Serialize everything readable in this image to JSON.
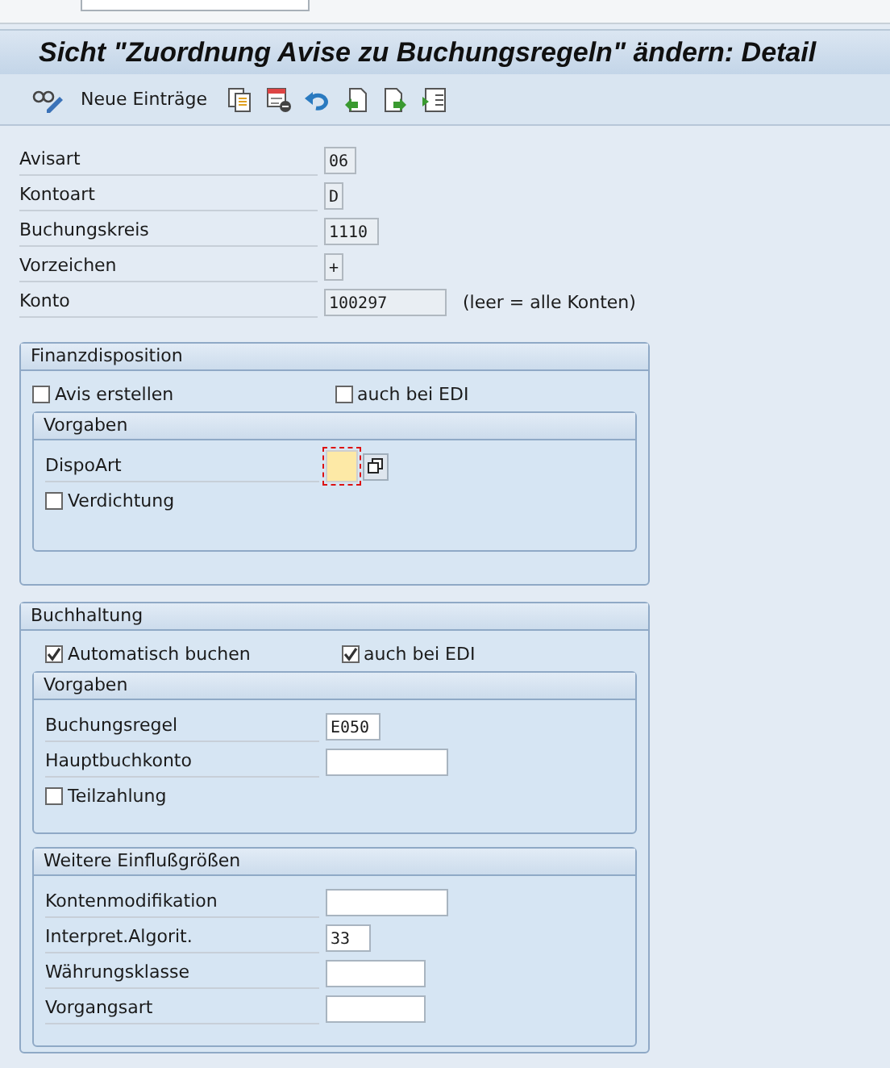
{
  "title": "Sicht \"Zuordnung Avise zu Buchungsregeln\" ändern: Detail",
  "toolbar": {
    "new_entries": "Neue Einträge"
  },
  "header_fields": [
    {
      "label": "Avisart",
      "value": "06",
      "kind": "display"
    },
    {
      "label": "Kontoart",
      "value": "D",
      "kind": "display"
    },
    {
      "label": "Buchungskreis",
      "value": "1110",
      "kind": "display"
    },
    {
      "label": "Vorzeichen",
      "value": "+",
      "kind": "display"
    },
    {
      "label": "Konto",
      "value": "100297",
      "kind": "display",
      "note": "(leer = alle Konten)"
    }
  ],
  "groups": [
    {
      "title": "Finanzdisposition",
      "checkboxes": [
        {
          "label": "Avis erstellen",
          "checked": false
        },
        {
          "label": "auch bei EDI",
          "checked": false
        }
      ],
      "subgroups": [
        {
          "title": "Vorgaben",
          "items": [
            {
              "kind": "field",
              "label": "DispoArt",
              "value": "",
              "required": true
            },
            {
              "kind": "checkbox",
              "label": "Verdichtung",
              "checked": false
            }
          ]
        }
      ]
    },
    {
      "title": "Buchhaltung",
      "checkboxes": [
        {
          "label": "Automatisch buchen",
          "checked": true
        },
        {
          "label": "auch bei EDI",
          "checked": true
        }
      ],
      "subgroups": [
        {
          "title": "Vorgaben",
          "items": [
            {
              "kind": "field",
              "label": "Buchungsregel",
              "value": "E050",
              "required": false
            },
            {
              "kind": "field",
              "label": "Hauptbuchkonto",
              "value": "",
              "required": false
            },
            {
              "kind": "checkbox",
              "label": "Teilzahlung",
              "checked": false
            }
          ]
        },
        {
          "title": "Weitere Einflußgrößen",
          "items": [
            {
              "kind": "field",
              "label": "Kontenmodifikation",
              "value": "",
              "required": false
            },
            {
              "kind": "field",
              "label": "Interpret.Algorit.",
              "value": "33",
              "required": false
            },
            {
              "kind": "field",
              "label": "Währungsklasse",
              "value": "",
              "required": false
            },
            {
              "kind": "field",
              "label": "Vorgangsart",
              "value": "",
              "required": false
            }
          ]
        }
      ]
    }
  ]
}
